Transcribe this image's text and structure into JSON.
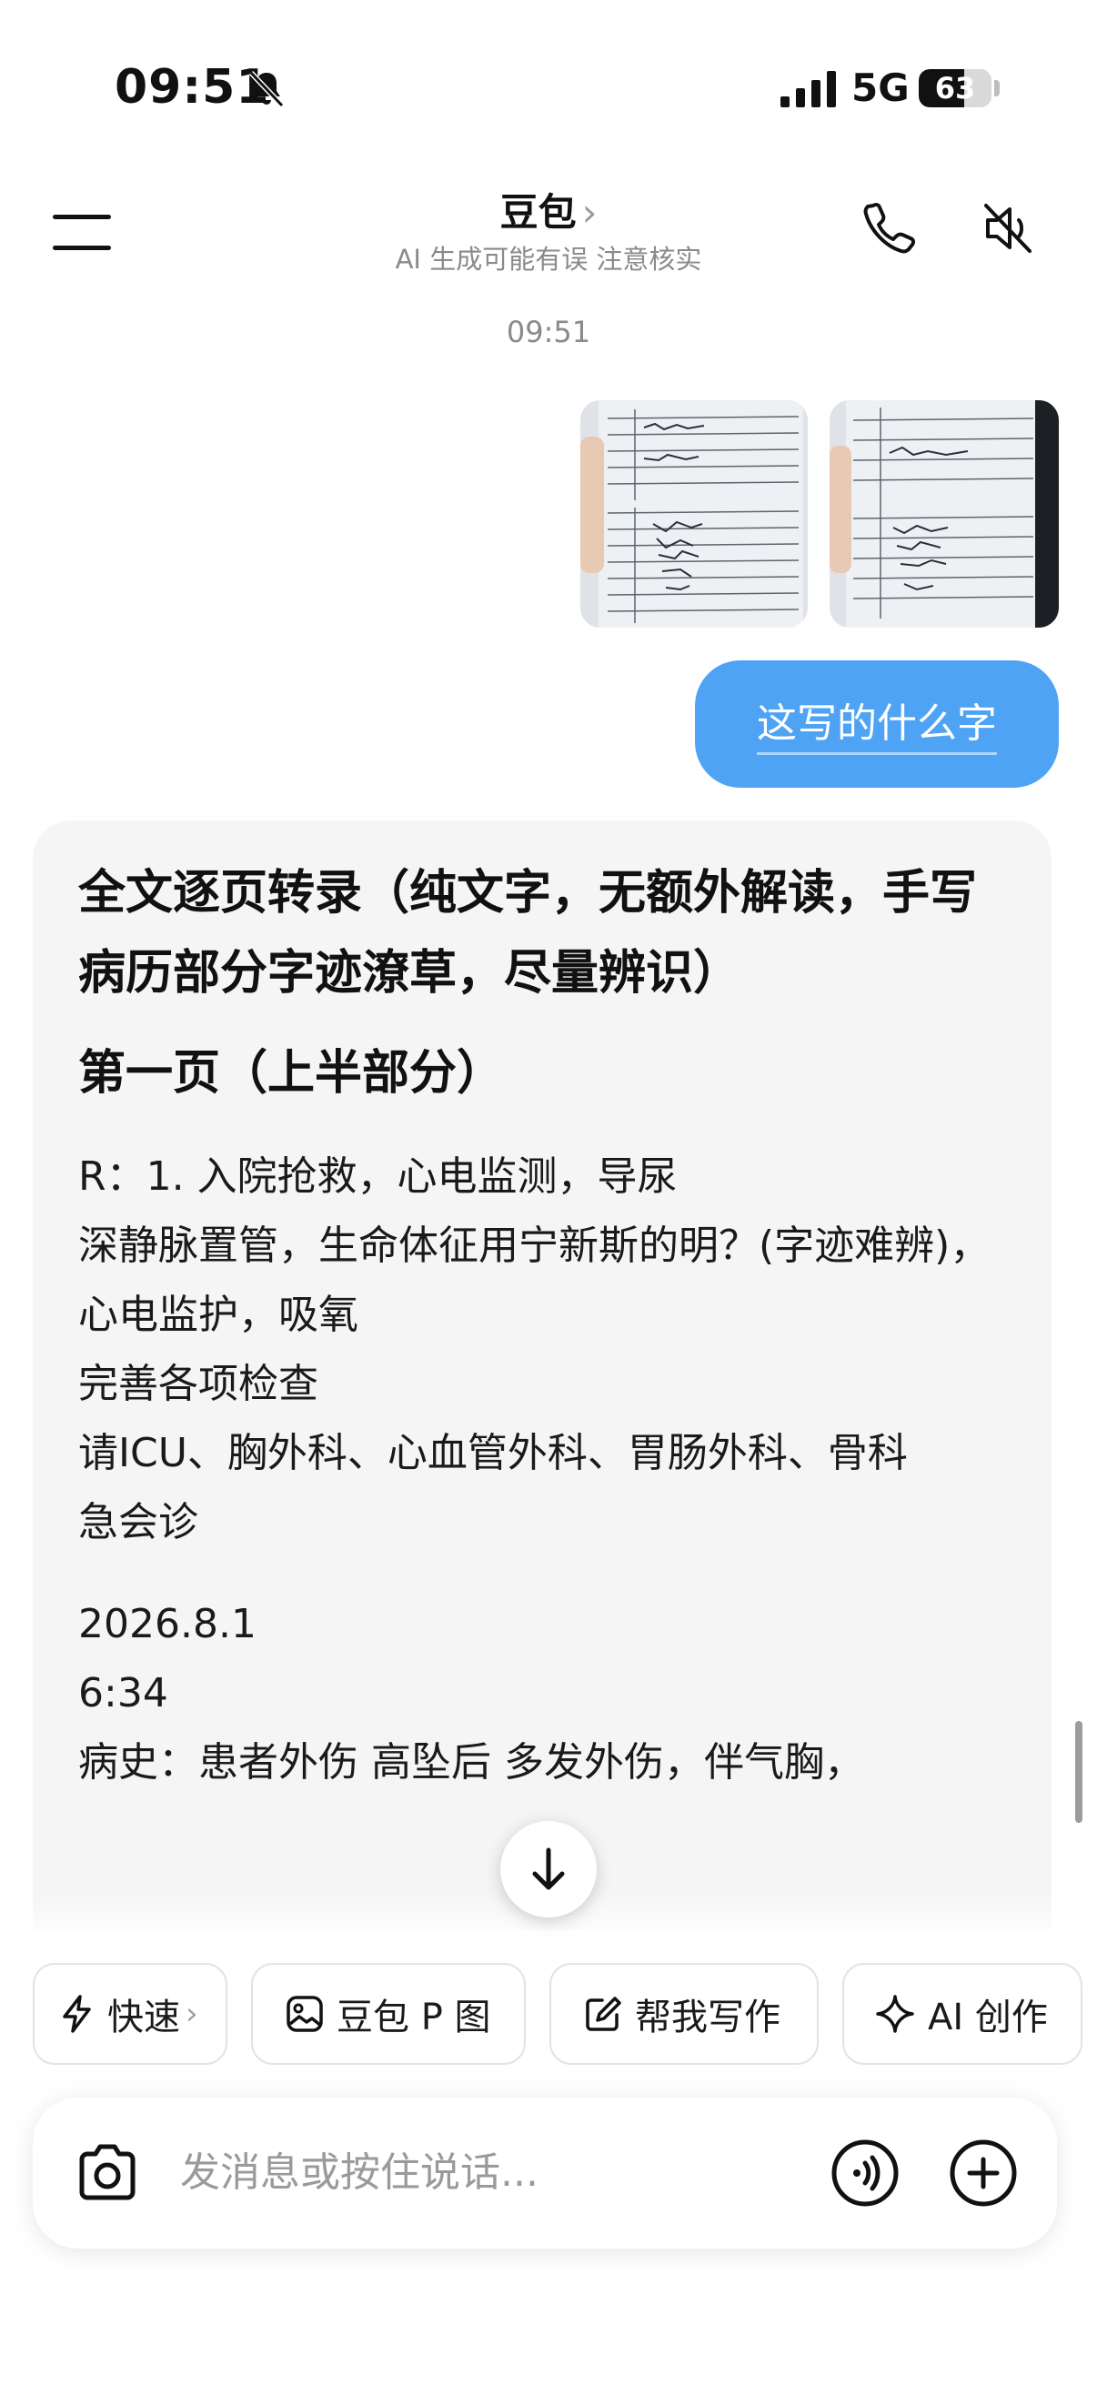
{
  "status_bar": {
    "time": "09:51",
    "network": "5G",
    "battery_percent": "63",
    "battery_level": 0.63
  },
  "header": {
    "title": "豆包",
    "title_chevron": "›",
    "subtitle": "AI 生成可能有误 注意核实"
  },
  "chat": {
    "timestamp": "09:51",
    "user_message": "这写的什么字",
    "answer": {
      "heading": "全文逐页转录（纯文字，无额外解读，手写病历部分字迹潦草，尽量辨识）",
      "section_title": "第一页（上半部分）",
      "paragraph_1": "R：1. 入院抢救，心电监测，导尿\n深静脉置管，生命体征用宁新斯的明？(字迹难辨)，心电监护，吸氧\n完善各项检查\n请ICU、胸外科、心血管外科、胃肠外科、骨科\n急会诊",
      "paragraph_2": "2026.8.1\n6:34\n病史：患者外伤 高坠后 多发外伤，伴气胸，"
    }
  },
  "quick_actions": {
    "fast": "快速",
    "fast_chevron": "›",
    "photo": "豆包 P 图",
    "write": "帮我写作",
    "ai_create": "AI 创作"
  },
  "input": {
    "placeholder": "发消息或按住说话..."
  },
  "icons": {
    "bell": "bell-slash-icon",
    "signal": "signal-bars-icon",
    "menu": "menu-icon",
    "phone": "phone-icon",
    "mute": "speaker-mute-icon",
    "scroll_down": "arrow-down-icon",
    "fast": "lightning-icon",
    "photo": "image-edit-icon",
    "write": "pencil-square-icon",
    "ai": "sparkle-icon",
    "camera": "camera-icon",
    "voice": "voice-wave-icon",
    "plus": "plus-circle-icon"
  }
}
